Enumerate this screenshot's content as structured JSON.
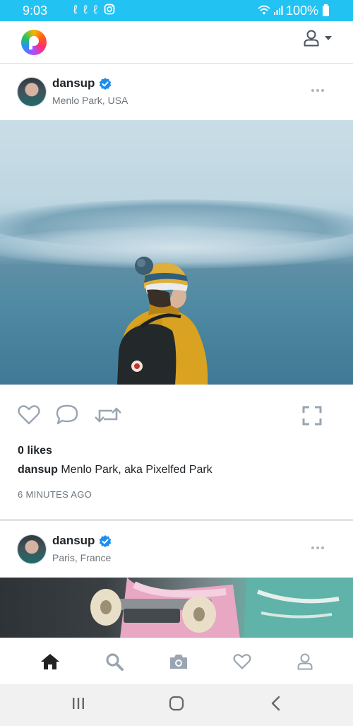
{
  "status_bar": {
    "time": "9:03",
    "notification_icons": [
      "clock-swirl-icon",
      "clock-swirl-icon",
      "clock-swirl-icon",
      "instagram-icon"
    ],
    "battery": "100%",
    "icons": [
      "wifi-icon",
      "signal-icon",
      "battery-icon"
    ]
  },
  "app_bar": {
    "logo": "pixelfed-logo",
    "user_menu_icon": "user-icon",
    "dropdown_icon": "caret-down-icon"
  },
  "posts": [
    {
      "username": "dansup",
      "verified": true,
      "location": "Menlo Park, USA",
      "likes": "0 likes",
      "caption_user": "dansup",
      "caption_text": "Menlo Park, aka Pixelfed Park",
      "timestamp": "6 MINUTES AGO"
    },
    {
      "username": "dansup",
      "verified": true,
      "location": "Paris, France"
    }
  ],
  "actions": [
    "heart-icon",
    "comment-icon",
    "share-icon",
    "expand-icon"
  ],
  "bottom_nav": [
    "home-icon",
    "search-icon",
    "camera-icon",
    "heart-icon",
    "user-icon"
  ],
  "system_nav": [
    "recents-icon",
    "home-icon",
    "back-icon"
  ],
  "colors": {
    "status_bar": "#22c3f2",
    "verified": "#1d8cf0",
    "icon_gray": "#9aa5b1"
  }
}
